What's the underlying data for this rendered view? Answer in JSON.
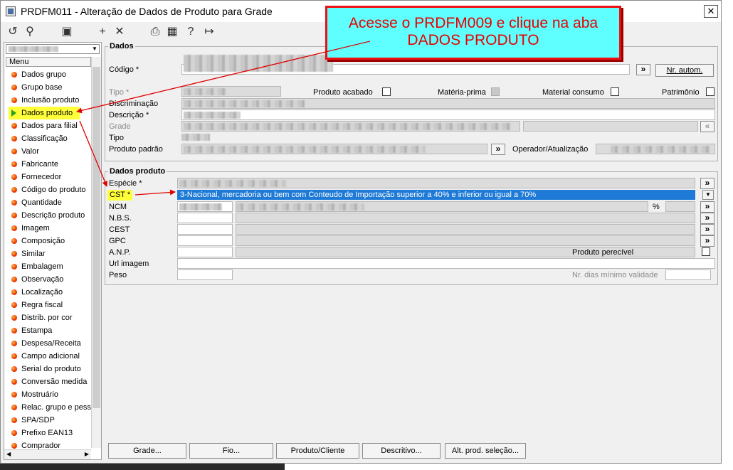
{
  "window": {
    "title": "PRDFM011 - Alteração de Dados de Produto para Grade",
    "close_label": "✕"
  },
  "toolbar": [
    {
      "icon": "refresh-icon",
      "glyph": "↺"
    },
    {
      "icon": "search-icon",
      "glyph": "⚲"
    },
    {
      "icon": "save-icon",
      "glyph": "▣"
    },
    {
      "icon": "add-icon",
      "glyph": "+"
    },
    {
      "icon": "delete-icon",
      "glyph": "✕"
    },
    {
      "icon": "print-icon",
      "glyph": "⎙"
    },
    {
      "icon": "calendar-icon",
      "glyph": "▦"
    },
    {
      "icon": "help-icon",
      "glyph": "?"
    },
    {
      "icon": "exit-icon",
      "glyph": "↦"
    }
  ],
  "menu": {
    "header": "Menu",
    "active_index": 3,
    "items": [
      "Dados grupo",
      "Grupo base",
      "Inclusão produto",
      "Dados produto",
      "Dados para filial",
      "Classificação",
      "Valor",
      "Fabricante",
      "Fornecedor",
      "Código do produto",
      "Quantidade",
      "Descrição produto",
      "Imagem",
      "Composição",
      "Similar",
      "Embalagem",
      "Observação",
      "Localização",
      "Regra fiscal",
      "Distrib. por cor",
      "Estampa",
      "Despesa/Receita",
      "Campo adicional",
      "Serial do produto",
      "Conversão medida",
      "Mostruário",
      "Relac. grupo e pess",
      "SPA/SDP",
      "Prefixo EAN13",
      "Comprador"
    ]
  },
  "dados": {
    "group_label": "Dados",
    "codigo_label": "Código *",
    "nr_autom_label": "Nr. autom.",
    "more_button": "»",
    "tipo_label": "Tipo *",
    "produto_acabado_label": "Produto acabado",
    "materia_prima_label": "Matéria-prima",
    "material_consumo_label": "Material consumo",
    "patrimonio_label": "Patrimônio",
    "discriminacao_label": "Discriminação",
    "descricao_label": "Descrição *",
    "grade_label": "Grade",
    "tipo2_label": "Tipo",
    "produto_padrao_label": "Produto padrão",
    "operador_label": "Operador/Atualização"
  },
  "dados_produto": {
    "group_label": "Dados produto",
    "especie_label": "Espécie *",
    "cst_label": "CST *",
    "cst_value": "3-Nacional, mercadoria ou bem com Conteudo de Importação superior a 40% e inferior ou igual a 70%",
    "ncm_label": "NCM",
    "percent_label": "%",
    "nbs_label": "N.B.S.",
    "cest_label": "CEST",
    "gpc_label": "GPC",
    "anp_label": "A.N.P.",
    "produto_perecivel_label": "Produto perecível",
    "url_imagem_label": "Url imagem",
    "peso_label": "Peso",
    "nr_dias_label": "Nr. dias mínimo validade"
  },
  "bottom_buttons": [
    "Grade...",
    "Fio...",
    "Produto/Cliente",
    "Descritivo...",
    "Alt. prod. seleção..."
  ],
  "callout": {
    "line1": "Acesse o PRDFM009 e clique na aba",
    "line2": "DADOS PRODUTO"
  },
  "colors": {
    "highlight": "#ffff3a",
    "callout_bg": "#5fffff",
    "callout_text": "#e80000",
    "selection": "#1e7ad6",
    "arrow": "#e00000"
  }
}
